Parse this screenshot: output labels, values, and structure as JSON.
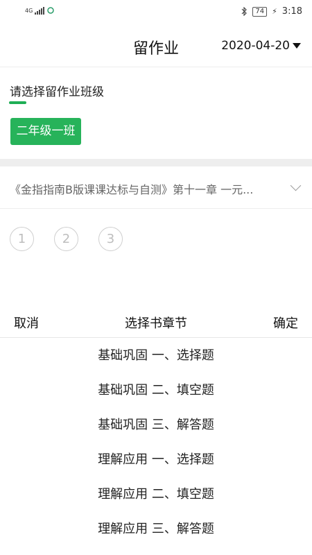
{
  "status_bar": {
    "network": "4G",
    "time": "3:18",
    "battery": "74"
  },
  "header": {
    "title": "留作业",
    "date": "2020-04-20"
  },
  "class_section": {
    "label": "请选择留作业班级",
    "selected_class": "二年级一班"
  },
  "book": {
    "title": "《金指指南B版课课达标与自测》第十一章 一元..."
  },
  "pages": [
    "1",
    "2",
    "3"
  ],
  "picker": {
    "cancel_label": "取消",
    "title": "选择书章节",
    "confirm_label": "确定",
    "options": [
      "基础巩固 一、选择题",
      "基础巩固 二、填空题",
      "基础巩固 三、解答题",
      "理解应用 一、选择题",
      "理解应用 二、填空题",
      "理解应用 三、解答题"
    ]
  },
  "colors": {
    "accent": "#27b35a"
  }
}
